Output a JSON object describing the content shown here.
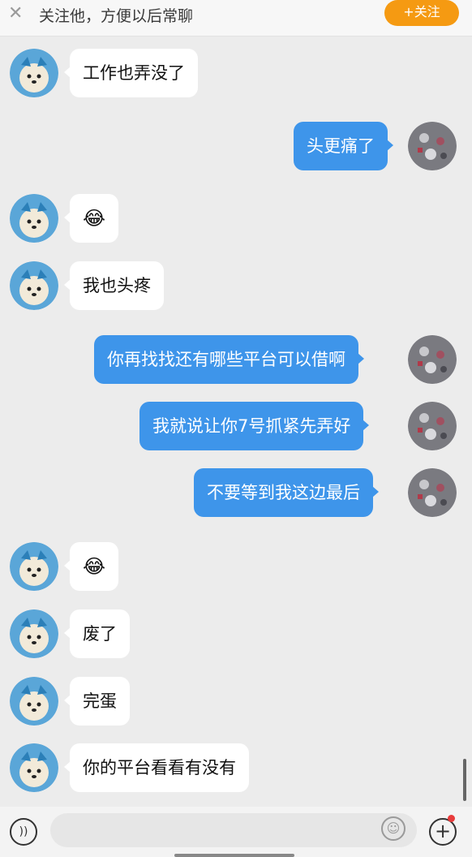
{
  "header": {
    "close_icon": "close-icon",
    "hint_text": "关注他，方便以后常聊",
    "follow_button": "+关注",
    "follow_color": "#f59a12"
  },
  "colors": {
    "background": "#ececec",
    "incoming_bubble": "#ffffff",
    "outgoing_bubble": "#3e95ea",
    "outgoing_text": "#ffffff"
  },
  "avatars": {
    "other_user": "dog-avatar",
    "self_user": "collage-avatar"
  },
  "messages": [
    {
      "side": "left",
      "text": "工作也弄没了"
    },
    {
      "side": "right",
      "text": "头更痛了"
    },
    {
      "side": "left",
      "text": "😂"
    },
    {
      "side": "left",
      "text": "我也头疼"
    },
    {
      "side": "right",
      "text": "你再找找还有哪些平台可以借啊"
    },
    {
      "side": "right",
      "text": "我就说让你7号抓紧先弄好"
    },
    {
      "side": "right",
      "text": "不要等到我这边最后"
    },
    {
      "side": "left",
      "text": "😂"
    },
    {
      "side": "left",
      "text": "废了"
    },
    {
      "side": "left",
      "text": "完蛋"
    },
    {
      "side": "left",
      "text": "你的平台看看有没有"
    }
  ],
  "bottom_bar": {
    "voice_icon": "voice-icon",
    "emoji_icon": "emoji-icon",
    "plus_icon": "plus-icon",
    "has_notification_dot": true
  }
}
